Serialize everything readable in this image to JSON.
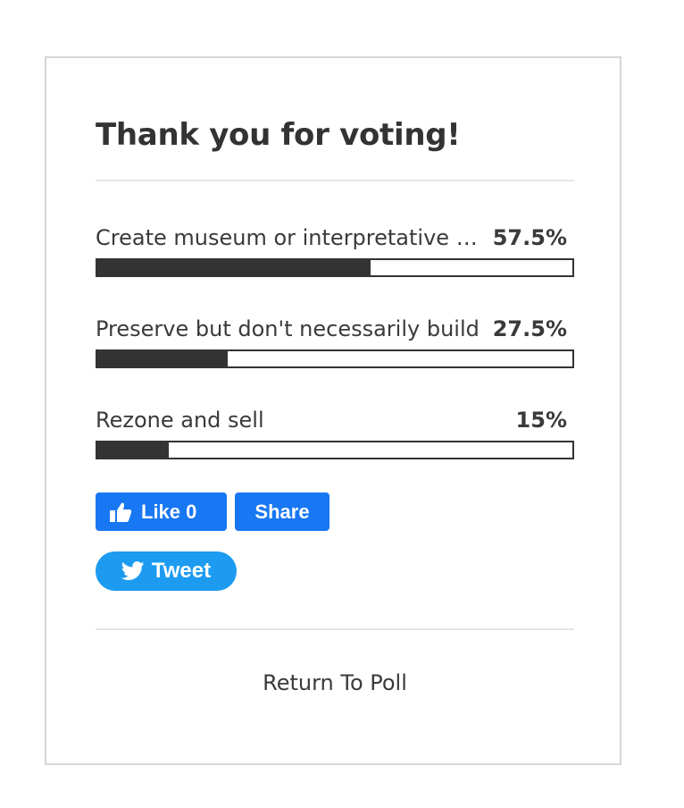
{
  "poll": {
    "title": "Thank you for voting!",
    "options": [
      {
        "label": "Create museum or interpretative center",
        "percent_label": "57.5%",
        "fraction": 0.575
      },
      {
        "label": "Preserve but don't necessarily build",
        "percent_label": "27.5%",
        "fraction": 0.275
      },
      {
        "label": "Rezone and sell",
        "percent_label": "15%",
        "fraction": 0.15
      }
    ],
    "return_label": "Return To Poll"
  },
  "social": {
    "like_label": "Like 0",
    "share_label": "Share",
    "tweet_label": "Tweet",
    "icons": [
      "thumbs-up-icon",
      "twitter-bird-icon"
    ]
  },
  "colors": {
    "bar_fill": "#333333",
    "facebook": "#1877f2",
    "twitter": "#1d9bf0",
    "border": "#d6d6d6"
  }
}
